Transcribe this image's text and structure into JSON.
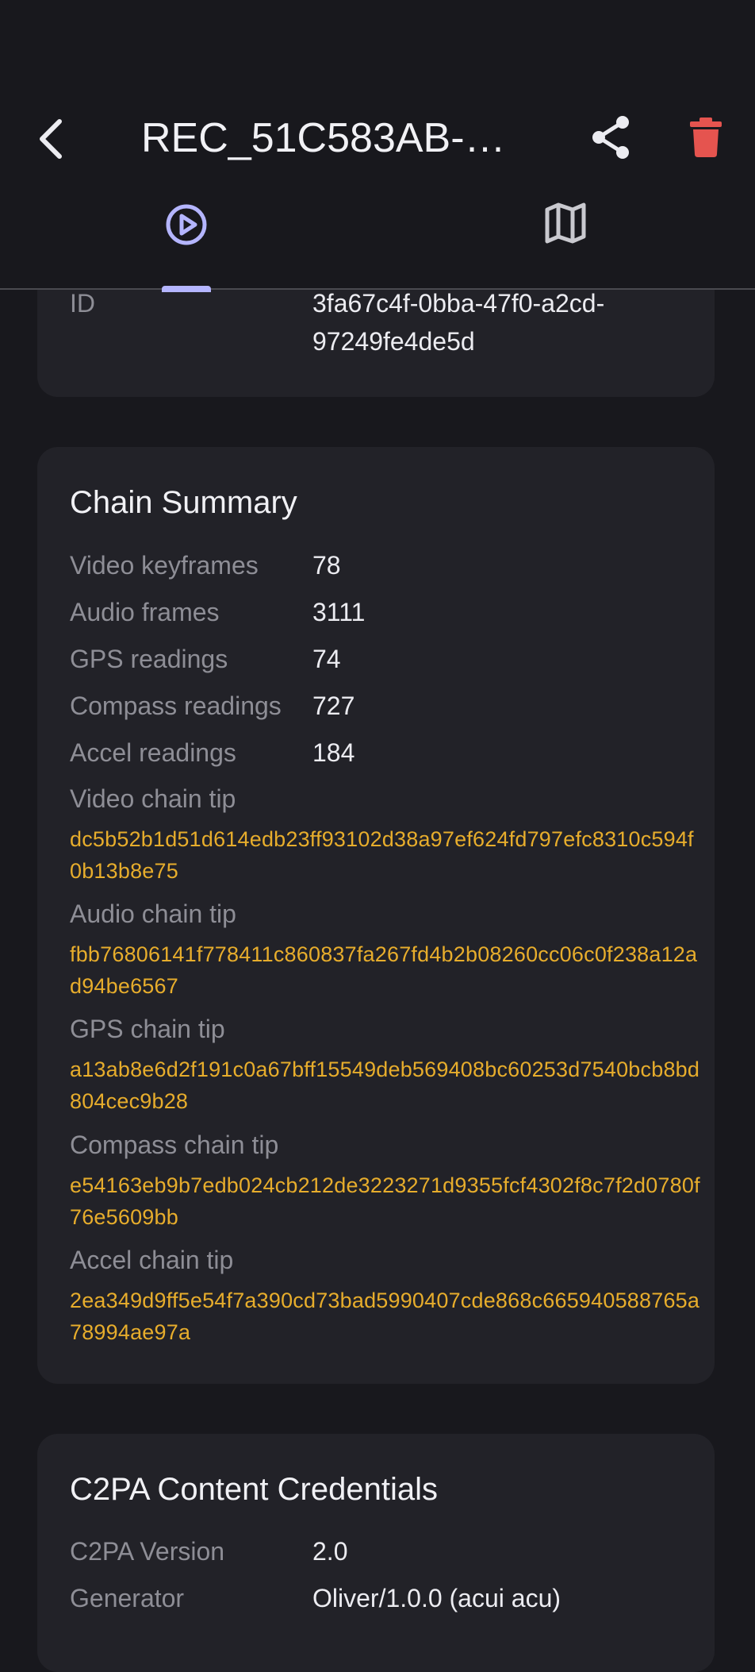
{
  "header": {
    "title": "REC_51C583AB-…",
    "back_icon": "chevron-left-icon",
    "share_icon": "share-icon",
    "delete_icon": "trash-icon",
    "delete_color": "#e5544f"
  },
  "tabs": [
    {
      "icon": "play-circle-icon",
      "selected": true
    },
    {
      "icon": "map-icon",
      "selected": false
    }
  ],
  "accent_color": "#b4b5ff",
  "hash_color": "#e7ad2c",
  "id_card": {
    "label": "ID",
    "value": "3fa67c4f-0bba-47f0-a2cd-97249fe4de5d"
  },
  "chain_summary": {
    "title": "Chain Summary",
    "rows": [
      {
        "label": "Video keyframes",
        "value": "78"
      },
      {
        "label": "Audio frames",
        "value": "3111"
      },
      {
        "label": "GPS readings",
        "value": "74"
      },
      {
        "label": "Compass readings",
        "value": "727"
      },
      {
        "label": "Accel readings",
        "value": "184"
      }
    ],
    "tips": [
      {
        "label": "Video chain tip",
        "hash": "dc5b52b1d51d614edb23ff93102d38a97ef624fd797efc8310c594f0b13b8e75"
      },
      {
        "label": "Audio chain tip",
        "hash": "fbb76806141f778411c860837fa267fd4b2b08260cc06c0f238a12ad94be6567"
      },
      {
        "label": "GPS chain tip",
        "hash": "a13ab8e6d2f191c0a67bff15549deb569408bc60253d7540bcb8bd804cec9b28"
      },
      {
        "label": "Compass chain tip",
        "hash": "e54163eb9b7edb024cb212de3223271d9355fcf4302f8c7f2d0780f76e5609bb"
      },
      {
        "label": "Accel chain tip",
        "hash": "2ea349d9ff5e54f7a390cd73bad5990407cde868c665940588765a78994ae97a"
      }
    ]
  },
  "c2pa": {
    "title": "C2PA Content Credentials",
    "rows": [
      {
        "label": "C2PA Version",
        "value": "2.0"
      },
      {
        "label": "Generator",
        "value": "Oliver/1.0.0 (acui acu)"
      }
    ]
  }
}
